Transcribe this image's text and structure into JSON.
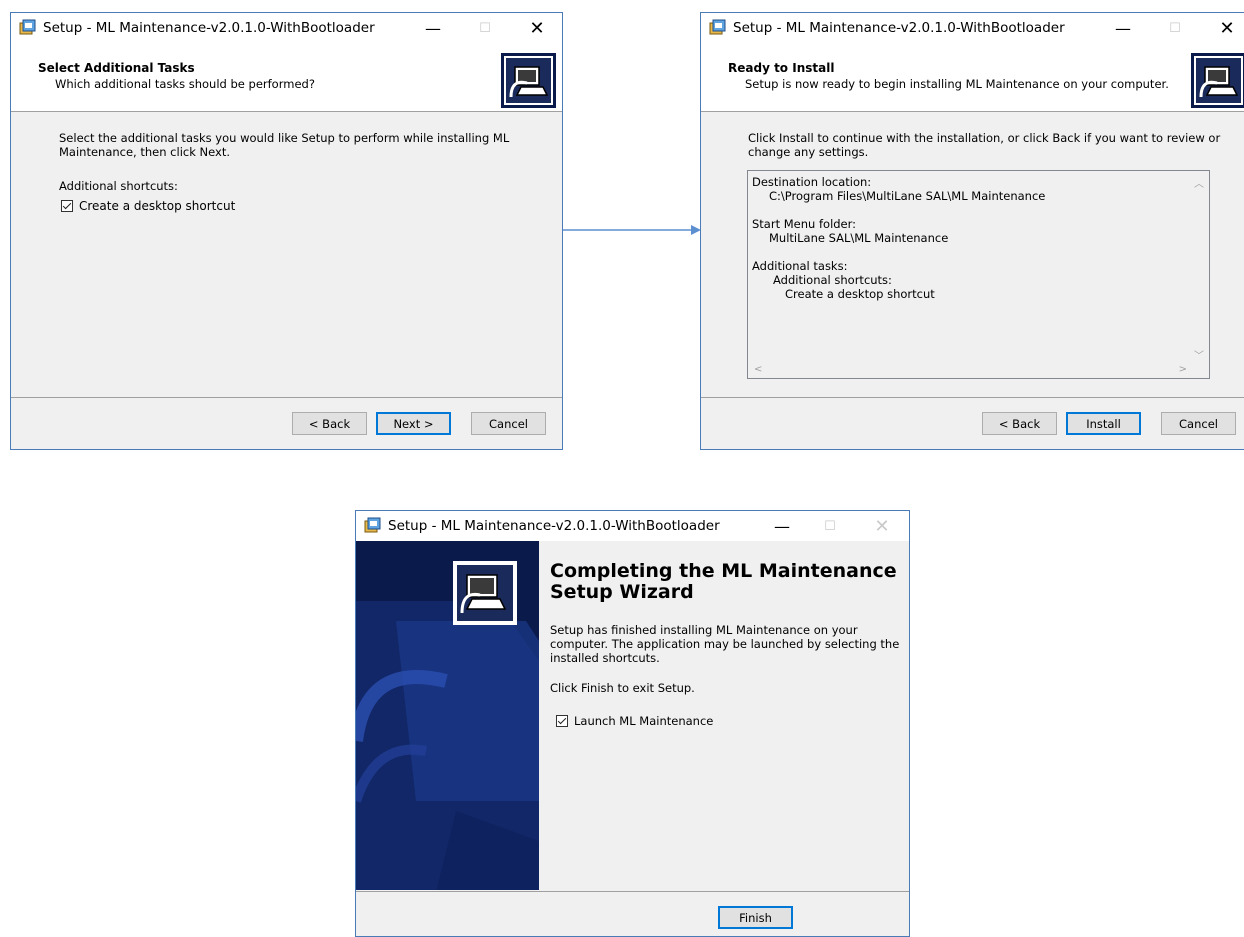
{
  "window1": {
    "title": "Setup - ML Maintenance-v2.0.1.0-WithBootloader",
    "header_title": "Select Additional Tasks",
    "header_subtitle": "Which additional tasks should be performed?",
    "intro_line1": "Select the additional tasks you would like Setup to perform while installing ML",
    "intro_line2": "Maintenance, then click Next.",
    "group_label": "Additional shortcuts:",
    "checkbox_label": "Create a desktop shortcut",
    "checkbox_checked": true,
    "back_label": "< Back",
    "next_label": "Next >",
    "cancel_label": "Cancel"
  },
  "window2": {
    "title": "Setup - ML Maintenance-v2.0.1.0-WithBootloader",
    "header_title": "Ready to Install",
    "header_subtitle": "Setup is now ready to begin installing ML Maintenance on your computer.",
    "intro_line1": "Click Install to continue with the installation, or click Back if you want to review or",
    "intro_line2": "change any settings.",
    "memo": {
      "dest_label": "Destination location:",
      "dest_value": "C:\\Program Files\\MultiLane SAL\\ML Maintenance",
      "menu_label": "Start Menu folder:",
      "menu_value": "MultiLane SAL\\ML Maintenance",
      "tasks_label": "Additional tasks:",
      "tasks_group": "Additional shortcuts:",
      "tasks_item": "Create a desktop shortcut"
    },
    "back_label": "< Back",
    "install_label": "Install",
    "cancel_label": "Cancel"
  },
  "window3": {
    "title": "Setup - ML Maintenance-v2.0.1.0-WithBootloader",
    "heading_line1": "Completing the ML Maintenance",
    "heading_line2": "Setup Wizard",
    "para1_line1": "Setup has finished installing ML Maintenance on your",
    "para1_line2": "computer. The application may be launched by selecting the",
    "para1_line3": "installed shortcuts.",
    "para2": "Click Finish to exit Setup.",
    "checkbox_label": "Launch ML Maintenance",
    "checkbox_checked": true,
    "finish_label": "Finish"
  },
  "colors": {
    "window_border": "#4a7ab8",
    "arrow": "#5b8fd0",
    "sidebar": "#0a1a4a",
    "default_button": "#0078d7"
  },
  "icons": [
    "setup-app-icon",
    "installer-computer-icon",
    "minimize-icon",
    "maximize-icon",
    "close-icon",
    "checkbox-icon",
    "scroll-up-icon",
    "scroll-down-icon",
    "scroll-left-icon",
    "scroll-right-icon",
    "arrow-connector"
  ]
}
